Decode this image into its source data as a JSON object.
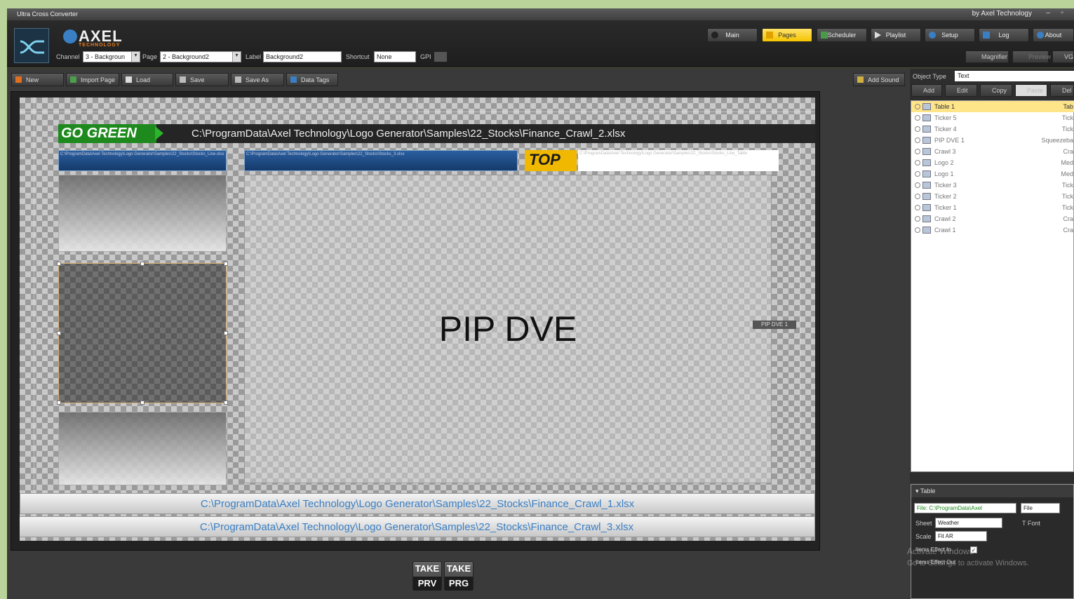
{
  "window": {
    "title": "Ultra Cross Converter",
    "credit": "by Axel Technology",
    "minimize": "–",
    "restore": "▫"
  },
  "brand": {
    "name": "AXEL",
    "sub": "TECHNOLOGY"
  },
  "nav": [
    "Main",
    "Pages",
    "Scheduler",
    "Playlist",
    "Setup",
    "Log",
    "About"
  ],
  "nav_active": "Pages",
  "nav_tools": [
    "Magnifier",
    "Preview",
    "VG"
  ],
  "fields": {
    "channel_label": "Channel",
    "channel_value": "3 - Backgroun",
    "page_label": "Page",
    "page_value": "2 - Background2",
    "label_label": "Label",
    "label_value": "Background2",
    "shortcut_label": "Shortcut",
    "shortcut_value": "None",
    "gpi_label": "GPI"
  },
  "toolbar": [
    "New",
    "Import Page",
    "Load",
    "Save",
    "Save As",
    "Data Tags"
  ],
  "add_sound": "Add Sound",
  "canvas": {
    "go_green": "GO GREEN",
    "crawl2_path": "C:\\ProgramData\\Axel Technology\\Logo Generator\\Samples\\22_Stocks\\Finance_Crawl_2.xlsx",
    "small_path_1": "C:\\ProgramData\\Axel Technology\\Logo Generator\\Samples\\22_Stocks\\Stocks_Line.xlsx",
    "small_path_2": "C:\\ProgramData\\Axel Technology\\Logo Generator\\Samples\\22_Stocks\\Stocks_3.xlsx",
    "small_path_3": "C:\\ProgramData\\Axel Technology\\Logo Generator\\Samples\\22_Stocks\\Stocks_Line_Table",
    "top_tag": "TOP",
    "pip_text": "PIP DVE",
    "pip_tag": "PIP DVE 1",
    "crawl1_path": "C:\\ProgramData\\Axel Technology\\Logo Generator\\Samples\\22_Stocks\\Finance_Crawl_1.xlsx",
    "crawl3_path": "C:\\ProgramData\\Axel Technology\\Logo Generator\\Samples\\22_Stocks\\Finance_Crawl_3.xlsx"
  },
  "take": {
    "top": "TAKE",
    "prv": "PRV",
    "prg": "PRG"
  },
  "panel": {
    "object_type_label": "Object Type",
    "object_type_value": "Text",
    "buttons": [
      "Add",
      "Edit",
      "Copy",
      "Paste",
      "Del"
    ],
    "objects": [
      {
        "name": "Table 1",
        "type": "Tab"
      },
      {
        "name": "Ticker 5",
        "type": "Tick"
      },
      {
        "name": "Ticker 4",
        "type": "Tick"
      },
      {
        "name": "PIP DVE 1",
        "type": "Squeezeba"
      },
      {
        "name": "Crawl 3",
        "type": "Cra"
      },
      {
        "name": "Logo 2",
        "type": "Med"
      },
      {
        "name": "Logo 1",
        "type": "Med"
      },
      {
        "name": "Ticker 3",
        "type": "Tick"
      },
      {
        "name": "Ticker 2",
        "type": "Tick"
      },
      {
        "name": "Ticker 1",
        "type": "Tick"
      },
      {
        "name": "Crawl 2",
        "type": "Cra"
      },
      {
        "name": "Crawl 1",
        "type": "Cra"
      }
    ],
    "table_header": "Table",
    "file_value": "File: C:\\ProgramData\\Axel",
    "file_type": "File",
    "sheet_label": "Sheet",
    "sheet_value": "Weather",
    "font_label": "Font",
    "scale_label": "Scale",
    "scale_value": "Fit AR",
    "effect_in": "Items Effect In",
    "effect_out": "Items Effect Out"
  },
  "watermark": {
    "line1": "Activate Windows",
    "line2": "Go to Settings to activate Windows."
  },
  "colors": {
    "accent": "#f5c400",
    "go_green": "#1e8a1e",
    "crawl_text": "#3a7fc4"
  }
}
